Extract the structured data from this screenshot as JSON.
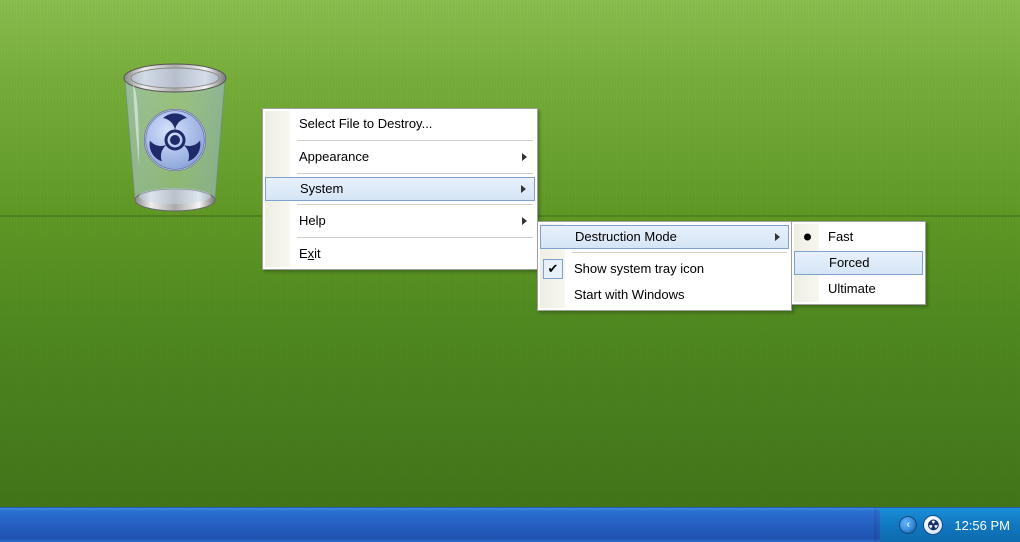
{
  "menu1": {
    "select_file": "Select File to Destroy...",
    "appearance": "Appearance",
    "system": "System",
    "help": "Help",
    "exit_pre": "E",
    "exit_u": "x",
    "exit_post": "it"
  },
  "menu2": {
    "destruction_mode": "Destruction Mode",
    "show_tray": "Show system tray icon",
    "start_windows": "Start with Windows"
  },
  "menu3": {
    "fast": "Fast",
    "forced": "Forced",
    "ultimate": "Ultimate"
  },
  "taskbar": {
    "clock": "12:56 PM",
    "chevron_glyph": "‹",
    "biohazard_glyph": "☢"
  }
}
